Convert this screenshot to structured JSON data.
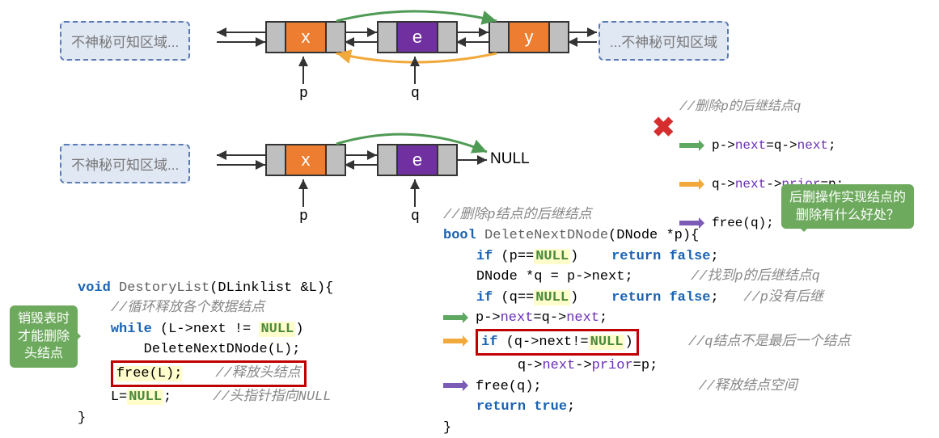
{
  "diagram1": {
    "region_left": "不神秘可知区域...",
    "region_right": "...不神秘可知区域",
    "nodes": [
      {
        "value": "x",
        "color": "orange"
      },
      {
        "value": "e",
        "color": "purple"
      },
      {
        "value": "y",
        "color": "orange"
      }
    ],
    "pointers": {
      "p": "p",
      "q": "q"
    }
  },
  "diagram2": {
    "region_left": "不神秘可知区域...",
    "nodes": [
      {
        "value": "x",
        "color": "orange"
      },
      {
        "value": "e",
        "color": "purple"
      }
    ],
    "null_label": "NULL",
    "pointers": {
      "p": "p",
      "q": "q"
    }
  },
  "legend": {
    "title": "//删除p的后继结点q",
    "lines": [
      "p->next=q->next;",
      "q->next->prior=p;",
      "free(q);"
    ]
  },
  "callouts": {
    "left1": "销毁表时",
    "left2": "才能删除",
    "left3": "头结点",
    "right1": "后删操作实现结点的",
    "right2": "删除有什么好处？"
  },
  "code_left": {
    "l1_kw": "void",
    "l1_fn": "DestoryList",
    "l1_rest": "(DLinklist &L){",
    "l2_cmt": "//循环释放各个数据结点",
    "l3_kw": "while",
    "l3_rest": " (L->next != ",
    "l3_null": "NULL",
    "l3_end": ")",
    "l4": "DeleteNextDNode(L);",
    "l5a": "free(L);",
    "l5_cmt": "//释放头结点",
    "l6a": "L=",
    "l6_null": "NULL",
    "l6b": ";",
    "l6_cmt": "//头指针指向NULL",
    "l7": "}"
  },
  "code_right": {
    "l1_cmt": "//删除p结点的后继结点",
    "l2_kw": "bool",
    "l2_fn": "DeleteNextDNode",
    "l2_rest": "(DNode *p){",
    "l3_kw": "if",
    "l3_a": " (p==",
    "l3_null": "NULL",
    "l3_b": ")    ",
    "l3_kw2": "return false",
    "l3_c": ";",
    "l4_a": "DNode *q = p->next;",
    "l4_cmt": "//找到p的后继结点q",
    "l5_kw": "if",
    "l5_a": " (q==",
    "l5_null": "NULL",
    "l5_b": ")    ",
    "l5_kw2": "return false",
    "l5_c": ";",
    "l5_cmt": "//p没有后继",
    "l6": "p->next=q->next;",
    "l7_kw": "if",
    "l7_a": " (q->next!=",
    "l7_null": "NULL",
    "l7_b": ")",
    "l7_cmt": "//q结点不是最后一个结点",
    "l8": "q->next->prior=p;",
    "l9": "free(q);",
    "l9_cmt": "//释放结点空间",
    "l10_kw": "return true",
    "l10_b": ";",
    "l11": "}"
  }
}
